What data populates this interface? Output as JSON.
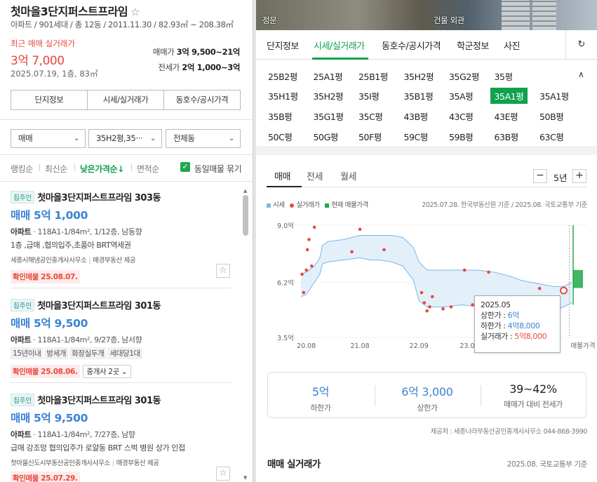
{
  "complex": {
    "title": "첫마을3단지퍼스트프라임",
    "star_icon": "☆",
    "subtitle": "아파트 / 901세대 / 총 12동 / 2011.11.30 / 82.93㎡ ~ 208.38㎡",
    "recent_label": "최근 매매 실거래가",
    "recent_price": "3억 7,000",
    "recent_date": "2025.07.19, 1층, 83㎡",
    "sale_label": "매매가",
    "sale_value": "3억 9,500~21억",
    "jeonse_label": "전세가",
    "jeonse_value": "2억 1,000~3억"
  },
  "left_tabs": [
    "단지정보",
    "시세/실거래가",
    "동호수/공시가격"
  ],
  "filters": {
    "trade": "매매",
    "area": "35H2평,35···",
    "dong": "전체동",
    "chevron": "⌄"
  },
  "sort": {
    "items": [
      "랭킹순",
      "최신순",
      "낮은가격순↓",
      "면적순"
    ],
    "active": "낮은가격순↓",
    "same_listing": "동일매물 묶기",
    "check": "✓"
  },
  "listings": [
    {
      "tag": "집주인",
      "name": "첫마을3단지퍼스트프라임 303동",
      "price": "매매 5억 1,000",
      "type": "아파트",
      "meta": "· 118A1-1/84m², 1/12층, 남동향",
      "desc": "1층 ,급매 ,협의입주,초품아 BRT역세권",
      "chips": [],
      "agent": "세종시해냄공인중개사사무소",
      "provider": "매경부동산 제공",
      "confirm": "확인매물 25.08.07.",
      "agents_btn": ""
    },
    {
      "tag": "집주인",
      "name": "첫마을3단지퍼스트프라임 301동",
      "price": "매매 5억 9,500",
      "type": "아파트",
      "meta": "· 118A1-1/84m², 9/27층, 남서향",
      "desc": "",
      "chips": [
        "15년이내",
        "방세개",
        "화장실두개",
        "세대당1대"
      ],
      "agent": "",
      "provider": "",
      "confirm": "확인매물 25.08.06.",
      "agents_btn": "중개사 2곳"
    },
    {
      "tag": "집주인",
      "name": "첫마을3단지퍼스트프라임 301동",
      "price": "매매 5억 9,500",
      "type": "아파트",
      "meta": "· 118A1-1/84m², 7/27층, 남향",
      "desc": "급매 강조망 협의입주가 로얄동 BRT 스벅 병원 상가 인접",
      "chips": [],
      "agent": "첫마을신도시부동산공인중개사사무소",
      "provider": "매경부동산 제공",
      "confirm": "확인매물 25.07.29.",
      "agents_btn": ""
    }
  ],
  "photos": {
    "left_caption": "정문",
    "right_caption": "건물 외관"
  },
  "right_tabs": [
    "단지정보",
    "시세/실거래가",
    "동호수/공시가격",
    "학군정보",
    "사진"
  ],
  "right_tab_active": "시세/실거래가",
  "refresh_icon": "↻",
  "areas": [
    "25B2평",
    "25A1평",
    "25B1평",
    "35H2평",
    "35G2평",
    "35평",
    "35H1평",
    "35H2평",
    "35I평",
    "35B1평",
    "35A평",
    "35A1평",
    "35A1평",
    "35B평",
    "35G1평",
    "35C평",
    "43B평",
    "43C평",
    "43E평",
    "50B평",
    "50C평",
    "50G평",
    "50F평",
    "59C평",
    "59B평",
    "63B평",
    "63C평"
  ],
  "area_selected_index": 11,
  "area_chevron": "∧",
  "chart_tabs": [
    "매매",
    "전세",
    "월세"
  ],
  "zoom": {
    "minus": "−",
    "label": "5년",
    "plus": "+"
  },
  "legend": {
    "band": "시세",
    "real": "실거래가",
    "current": "현재 매물가격",
    "source": "2025.07.28. 한국부동산원 기준 / 2025.08. 국토교통부 기준"
  },
  "tooltip": {
    "date": "2025.05",
    "upper_label": "상한가 : ",
    "upper": "6억",
    "lower_label": "하한가 : ",
    "lower": "4억8,000",
    "real_label": "실거래가 : ",
    "real": "5억8,000"
  },
  "colors": {
    "accent_green": "#10a14f",
    "band_line": "#7ab7e3",
    "band_fill": "#e3f0fa",
    "dot_red": "#e8483d",
    "current_green": "#22a84a"
  },
  "chart_data": {
    "type": "area",
    "ylim": [
      3.5,
      9.0
    ],
    "y_ticks": [
      "9.0억",
      "6.2억",
      "3.5억"
    ],
    "y_tick_values": [
      9.0,
      6.2,
      3.5
    ],
    "x_ticks": [
      "20.08",
      "21.08",
      "22.09",
      "23.0",
      "매물가격"
    ],
    "x_tick_values": [
      2020.6,
      2021.6,
      2022.7,
      2023.6
    ],
    "x_range": [
      2020.5,
      2025.55
    ],
    "series": [
      {
        "name": "",
        "kind": "upper",
        "x": [
          2020.5,
          2020.6,
          2020.75,
          2020.85,
          2020.9,
          2021.0,
          2021.3,
          2021.6,
          2021.8,
          2021.95,
          2022.2,
          2022.4,
          2022.6,
          2022.7,
          2022.85,
          2023.0,
          2023.2,
          2023.5,
          2023.8,
          2024.1,
          2024.4,
          2024.6,
          2024.8,
          2025.0,
          2025.2,
          2025.4,
          2025.55
        ],
        "values": [
          6.6,
          6.7,
          7.0,
          7.4,
          8.0,
          8.2,
          8.3,
          8.5,
          8.5,
          8.5,
          8.5,
          8.4,
          7.9,
          7.2,
          6.8,
          6.8,
          6.8,
          6.8,
          6.8,
          6.7,
          6.5,
          6.3,
          6.2,
          6.1,
          6.0,
          6.0,
          6.2
        ]
      },
      {
        "name": "",
        "kind": "lower",
        "x": [
          2020.5,
          2020.6,
          2020.75,
          2020.85,
          2020.9,
          2021.0,
          2021.3,
          2021.6,
          2021.8,
          2021.95,
          2022.2,
          2022.4,
          2022.6,
          2022.7,
          2022.85,
          2023.0,
          2023.2,
          2023.5,
          2023.8,
          2024.1,
          2024.4,
          2024.6,
          2024.8,
          2025.0,
          2025.2,
          2025.4,
          2025.55
        ],
        "values": [
          5.5,
          5.6,
          6.2,
          6.6,
          7.1,
          7.2,
          7.3,
          7.4,
          7.3,
          7.3,
          7.2,
          7.0,
          6.3,
          5.3,
          5.0,
          5.0,
          5.0,
          5.1,
          5.0,
          4.9,
          4.9,
          5.0,
          4.9,
          5.0,
          4.8,
          5.0,
          5.2
        ]
      }
    ],
    "real_trades": {
      "name": "실거래가",
      "x": [
        2020.52,
        2020.55,
        2020.6,
        2020.62,
        2020.65,
        2020.7,
        2020.75,
        2021.45,
        2021.6,
        2022.05,
        2022.75,
        2022.8,
        2022.85,
        2022.9,
        2022.95,
        2023.15,
        2023.3,
        2023.55,
        2023.7,
        2024.0,
        2024.95,
        2025.4
      ],
      "values": [
        6.6,
        5.7,
        6.8,
        7.8,
        8.3,
        7.0,
        8.9,
        7.7,
        8.8,
        7.8,
        5.7,
        5.2,
        4.8,
        5.0,
        5.5,
        4.9,
        5.0,
        6.8,
        5.1,
        6.7,
        5.9,
        5.8
      ]
    },
    "current_listing_range": [
      5.1,
      9.0
    ],
    "current_listing_box": [
      6.2,
      6.6
    ],
    "highlight_x": 2025.4
  },
  "summary": [
    {
      "value": "5억",
      "label": "하한가"
    },
    {
      "value": "6억 3,000",
      "label": "상한가"
    },
    {
      "value": "39~42%",
      "label": "매매가 대비 전세가"
    }
  ],
  "provider_note": "제공처 : 세종나라부동산공인중개사사무소 044-868-3990",
  "section": {
    "title": "매매 실거래가",
    "note": "2025.08. 국토교통부 기준"
  }
}
